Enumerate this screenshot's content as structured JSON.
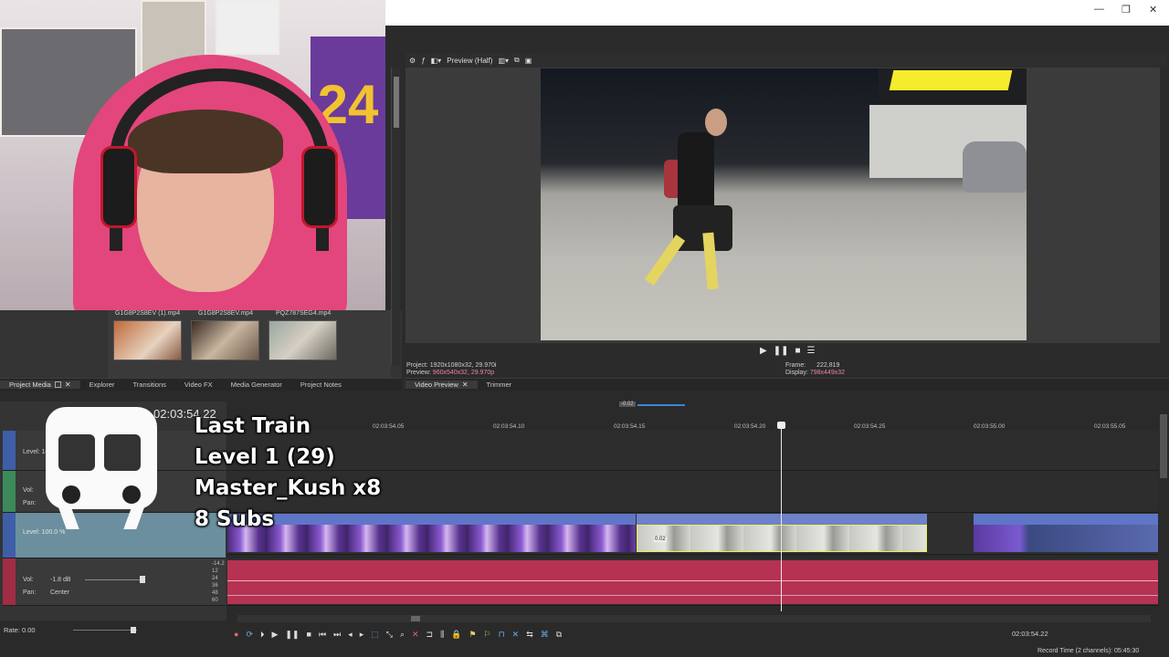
{
  "window": {
    "min": "—",
    "max": "❐",
    "close": "✕"
  },
  "media": {
    "thumbs": [
      {
        "label": "G1G8P2S8EV (1).mp4"
      },
      {
        "label": "G1G8P2S8EV.mp4"
      },
      {
        "label": "PQZ787SEG4.mp4"
      }
    ]
  },
  "tabs_left": [
    "Project Media",
    "Explorer",
    "Transitions",
    "Video FX",
    "Media Generator",
    "Project Notes"
  ],
  "tabs_right": [
    "Video Preview",
    "Trimmer"
  ],
  "preview": {
    "dropdown": "Preview (Half)",
    "project_label": "Project:",
    "project_value": "1920x1080x32, 29.970i",
    "preview_label": "Preview:",
    "preview_value": "960x540x32, 29.970p",
    "frame_label": "Frame:",
    "frame_value": "222,819",
    "display_label": "Display:",
    "display_value": "798x449x32"
  },
  "timeline": {
    "timecode": "02:03:54.22",
    "loop_label": "-0.02",
    "ticks": [
      "02:03:54.05",
      "02:03:54.10",
      "02:03:54.15",
      "02:03:54.20",
      "02:03:54.25",
      "02:03:55.00",
      "02:03:55.05"
    ],
    "track1_level": "Level: 100.0 %",
    "track2_vol": "Vol:",
    "track2_pan": "Pan:",
    "track3_level": "Level: 100.0 %",
    "track4_vol": "Vol:",
    "track4_vol_value": "-1.8 dB",
    "track4_pan": "Pan:",
    "track4_pan_value": "Center",
    "db_scale": [
      "-14.2",
      "12",
      "24",
      "36",
      "48",
      "60"
    ],
    "clip_mark": "0.02",
    "rate": "Rate: 0.00",
    "cursor_time": "02:03:54.22",
    "record_time": "Record Time (2 channels): 05:45:30"
  },
  "overlay": {
    "lines": [
      "Last Train",
      "Level 1  (29)",
      "Master_Kush x8",
      "8 Subs"
    ]
  },
  "colors": {
    "video_clip": "#5f76c6",
    "audio_clip": "#b53252",
    "accent": "#3b86d6"
  }
}
